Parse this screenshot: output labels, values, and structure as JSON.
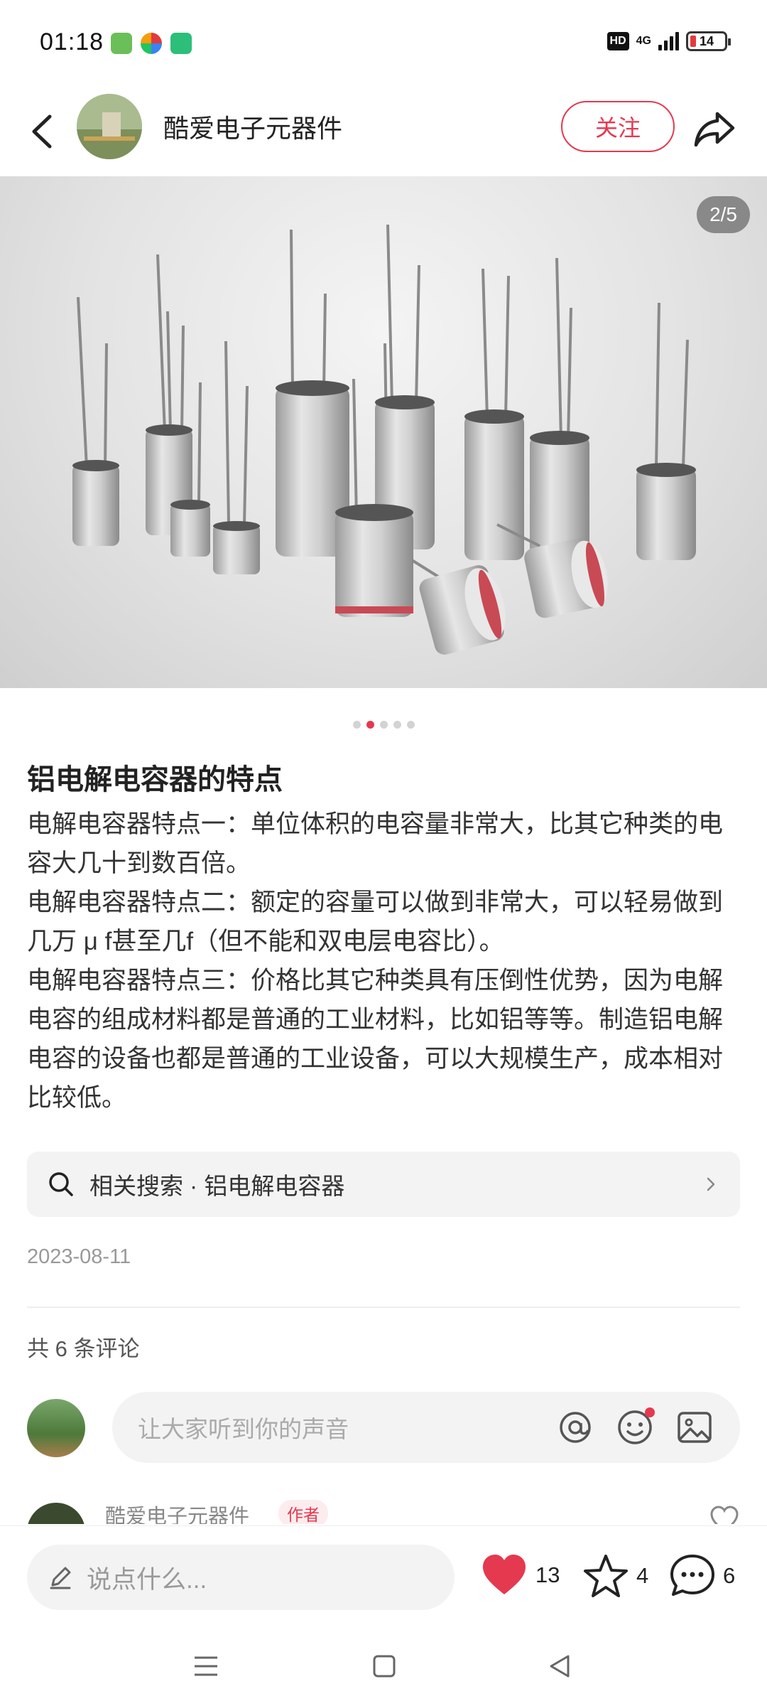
{
  "status": {
    "time": "01:18",
    "signal_label": "4G",
    "battery_level": "14"
  },
  "header": {
    "author_name": "酷爱电子元器件",
    "follow_label": "关注"
  },
  "gallery": {
    "page_counter": "2/5",
    "current_index": 2,
    "total": 5
  },
  "post": {
    "title": "铝电解电容器的特点",
    "paragraphs": [
      "电解电容器特点一：单位体积的电容量非常大，比其它种类的电容大几十到数百倍。",
      "电解电容器特点二：额定的容量可以做到非常大，可以轻易做到几万 μ f甚至几f（但不能和双电层电容比）。",
      "电解电容器特点三：价格比其它种类具有压倒性优势，因为电解电容的组成材料都是普通的工业材料，比如铝等等。制造铝电解电容的设备也都是普通的工业设备，可以大规模生产，成本相对比较低。"
    ],
    "related_search": "相关搜索 · 铝电解电容器",
    "date": "2023-08-11"
  },
  "comments": {
    "count_label": "共 6 条评论",
    "input_placeholder": "让大家听到你的声音",
    "first": {
      "name": "酷爱电子元器件",
      "badge": "作者"
    }
  },
  "bottom": {
    "say_placeholder": "说点什么...",
    "likes": "13",
    "stars": "4",
    "comments": "6"
  },
  "colors": {
    "accent": "#e5394f"
  }
}
